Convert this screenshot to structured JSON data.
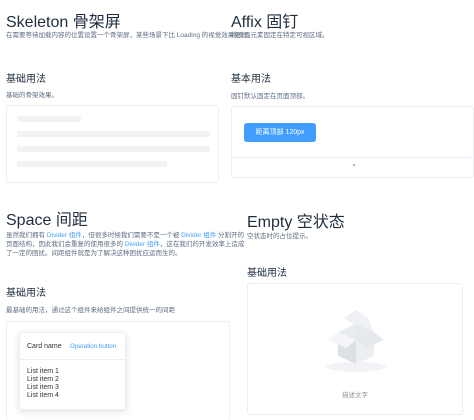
{
  "skeleton": {
    "title": "Skeleton 骨架屏",
    "desc": "在需要等待加载内容的位置设置一个骨架屏，某些场景下比 Loading 的视觉效果更好。",
    "sub_title": "基础用法",
    "sub_desc": "基础的骨架效果。"
  },
  "affix": {
    "title": "Affix 固钉",
    "desc": "将页面元素固定在特定可视区域。",
    "sub_title": "基本用法",
    "sub_desc": "固钉默认固定在页面顶部。",
    "button_label": "距离顶部 120px",
    "expand_icon": "caret-down-icon"
  },
  "space": {
    "title": "Space 间距",
    "desc_lines": [
      [
        "虽然我们拥有 ",
        "Divider 组件",
        "，但很多时候我们需要不是一个被 ",
        "Divider 组件",
        " 分割开的"
      ],
      [
        "页面结构，因此我们会重复的使用很多的 ",
        "Divider 组件",
        "，这在我们的开发效率上造成"
      ],
      [
        "了一定的困扰。间距组件就是为了解决这种困扰应运而生的。"
      ]
    ],
    "sub_title": "基础用法",
    "sub_desc": "最基础的用法，通过这个组件来给组件之间提供统一的间距",
    "card": {
      "name": "Card name",
      "operation": "Operation button",
      "items": [
        "List item 1",
        "List item 2",
        "List item 3",
        "List item 4"
      ]
    }
  },
  "empty": {
    "title": "Empty 空状态",
    "desc": "空状态时的占位提示。",
    "sub_title": "基础用法",
    "empty_text": "描述文字",
    "illustration": "empty-box-icon"
  },
  "colors": {
    "primary": "#409eff",
    "text": "#303133",
    "muted": "#5e6d82"
  }
}
